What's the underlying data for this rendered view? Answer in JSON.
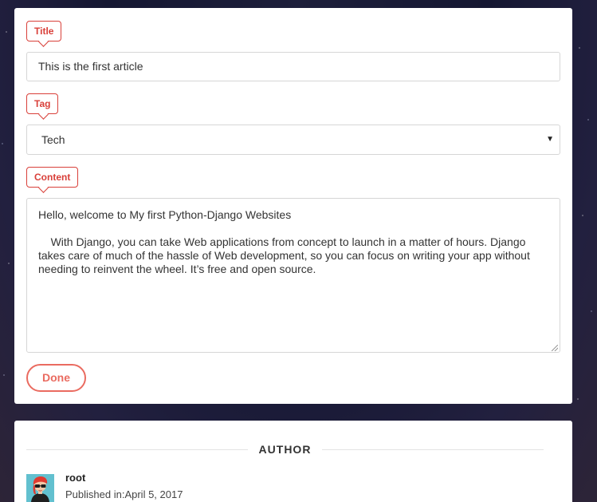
{
  "form": {
    "title_label": "Title",
    "title_value": "This is the first article",
    "tag_label": "Tag",
    "tag_selected": "Tech",
    "content_label": "Content",
    "content_value": "Hello, welcome to My first Python-Django Websites\n\n    With Django, you can take Web applications from concept to launch in a matter of hours. Django takes care of much of the hassle of Web development, so you can focus on writing your app without needing to reinvent the wheel. It’s free and open source.",
    "done_label": "Done"
  },
  "author": {
    "heading": "AUTHOR",
    "name": "root",
    "published_label": "Published in:",
    "published_date": "April 5, 2017"
  },
  "icons": {
    "select_arrow": "dropdown-arrow-icon",
    "avatar": "user-avatar-icon"
  },
  "colors": {
    "accent": "#d9403a",
    "button": "#ea6b60",
    "avatar_bg": "#62c0cf"
  }
}
